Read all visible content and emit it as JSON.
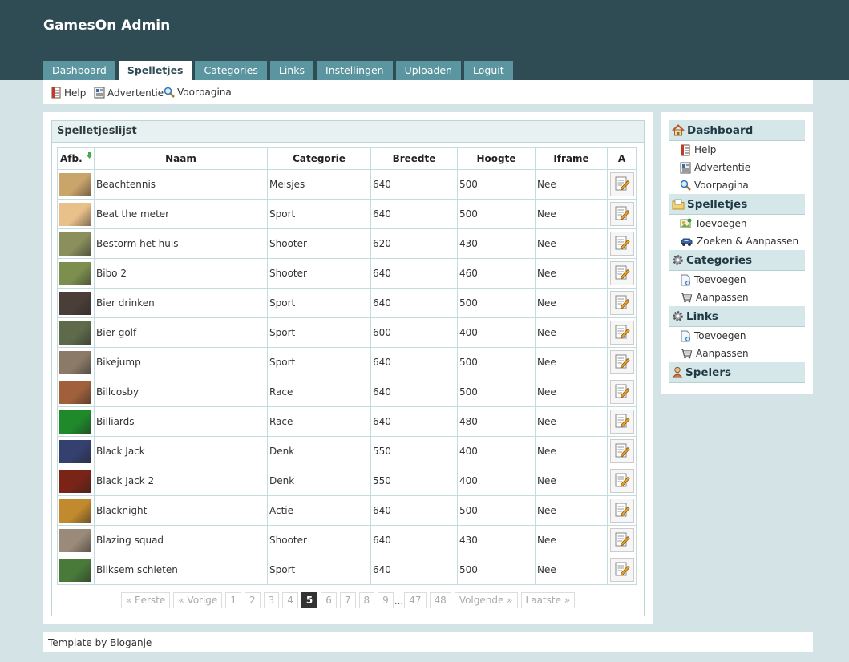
{
  "app": {
    "title": "GamesOn Admin"
  },
  "nav": [
    {
      "label": "Dashboard",
      "active": false
    },
    {
      "label": "Spelletjes",
      "active": true
    },
    {
      "label": "Categories",
      "active": false
    },
    {
      "label": "Links",
      "active": false
    },
    {
      "label": "Instellingen",
      "active": false
    },
    {
      "label": "Uploaden",
      "active": false
    },
    {
      "label": "Loguit",
      "active": false
    }
  ],
  "subnav": [
    {
      "label": "Help",
      "icon": "document-icon"
    },
    {
      "label": "Advertentie",
      "icon": "newspaper-icon"
    },
    {
      "label": "Voorpagina",
      "icon": "magnifier-icon"
    }
  ],
  "panel": {
    "title": "Spelletjeslijst"
  },
  "table": {
    "columns": [
      "Afb.",
      "Naam",
      "Categorie",
      "Breedte",
      "Hoogte",
      "Iframe",
      "A"
    ],
    "rows": [
      {
        "name": "Beachtennis",
        "category": "Meisjes",
        "width": "640",
        "height": "500",
        "iframe": "Nee",
        "thumb_color": "#c9a46b"
      },
      {
        "name": "Beat the meter",
        "category": "Sport",
        "width": "640",
        "height": "500",
        "iframe": "Nee",
        "thumb_color": "#e8c08a"
      },
      {
        "name": "Bestorm het huis",
        "category": "Shooter",
        "width": "620",
        "height": "430",
        "iframe": "Nee",
        "thumb_color": "#8a8f5c"
      },
      {
        "name": "Bibo 2",
        "category": "Shooter",
        "width": "640",
        "height": "460",
        "iframe": "Nee",
        "thumb_color": "#7d8f4e"
      },
      {
        "name": "Bier drinken",
        "category": "Sport",
        "width": "640",
        "height": "500",
        "iframe": "Nee",
        "thumb_color": "#4a3e38"
      },
      {
        "name": "Bier golf",
        "category": "Sport",
        "width": "600",
        "height": "400",
        "iframe": "Nee",
        "thumb_color": "#5e6b4a"
      },
      {
        "name": "Bikejump",
        "category": "Sport",
        "width": "640",
        "height": "500",
        "iframe": "Nee",
        "thumb_color": "#8c7a68"
      },
      {
        "name": "Billcosby",
        "category": "Race",
        "width": "640",
        "height": "500",
        "iframe": "Nee",
        "thumb_color": "#a0603c"
      },
      {
        "name": "Billiards",
        "category": "Race",
        "width": "640",
        "height": "480",
        "iframe": "Nee",
        "thumb_color": "#1f8a2a"
      },
      {
        "name": "Black Jack",
        "category": "Denk",
        "width": "550",
        "height": "400",
        "iframe": "Nee",
        "thumb_color": "#34406e"
      },
      {
        "name": "Black Jack 2",
        "category": "Denk",
        "width": "550",
        "height": "400",
        "iframe": "Nee",
        "thumb_color": "#7a2418"
      },
      {
        "name": "Blacknight",
        "category": "Actie",
        "width": "640",
        "height": "500",
        "iframe": "Nee",
        "thumb_color": "#c28a2e"
      },
      {
        "name": "Blazing squad",
        "category": "Shooter",
        "width": "640",
        "height": "430",
        "iframe": "Nee",
        "thumb_color": "#9a8a7a"
      },
      {
        "name": "Bliksem schieten",
        "category": "Sport",
        "width": "640",
        "height": "500",
        "iframe": "Nee",
        "thumb_color": "#4a7a3a"
      }
    ]
  },
  "pager": {
    "first": "« Eerste",
    "prev": "« Vorige",
    "pages": [
      "1",
      "2",
      "3",
      "4",
      "5",
      "6",
      "7",
      "8",
      "9"
    ],
    "current": "5",
    "ellipsis": "...",
    "tail": [
      "47",
      "48"
    ],
    "next": "Volgende »",
    "last": "Laatste »"
  },
  "sidebar": [
    {
      "title": "Dashboard",
      "icon": "home-icon",
      "items": [
        {
          "label": "Help",
          "icon": "document-icon"
        },
        {
          "label": "Advertentie",
          "icon": "newspaper-icon"
        },
        {
          "label": "Voorpagina",
          "icon": "magnifier-icon"
        }
      ]
    },
    {
      "title": "Spelletjes",
      "icon": "folder-icon",
      "items": [
        {
          "label": "Toevoegen",
          "icon": "add-picture-icon"
        },
        {
          "label": "Zoeken & Aanpassen",
          "icon": "car-icon"
        }
      ]
    },
    {
      "title": "Categories",
      "icon": "gear-icon",
      "items": [
        {
          "label": "Toevoegen",
          "icon": "add-document-icon"
        },
        {
          "label": "Aanpassen",
          "icon": "cart-icon"
        }
      ]
    },
    {
      "title": "Links",
      "icon": "gear-icon",
      "items": [
        {
          "label": "Toevoegen",
          "icon": "add-document-icon"
        },
        {
          "label": "Aanpassen",
          "icon": "cart-icon"
        }
      ]
    },
    {
      "title": "Spelers",
      "icon": "user-icon",
      "items": []
    }
  ],
  "footer": {
    "prefix": "Template by ",
    "author": "Bloganje"
  }
}
